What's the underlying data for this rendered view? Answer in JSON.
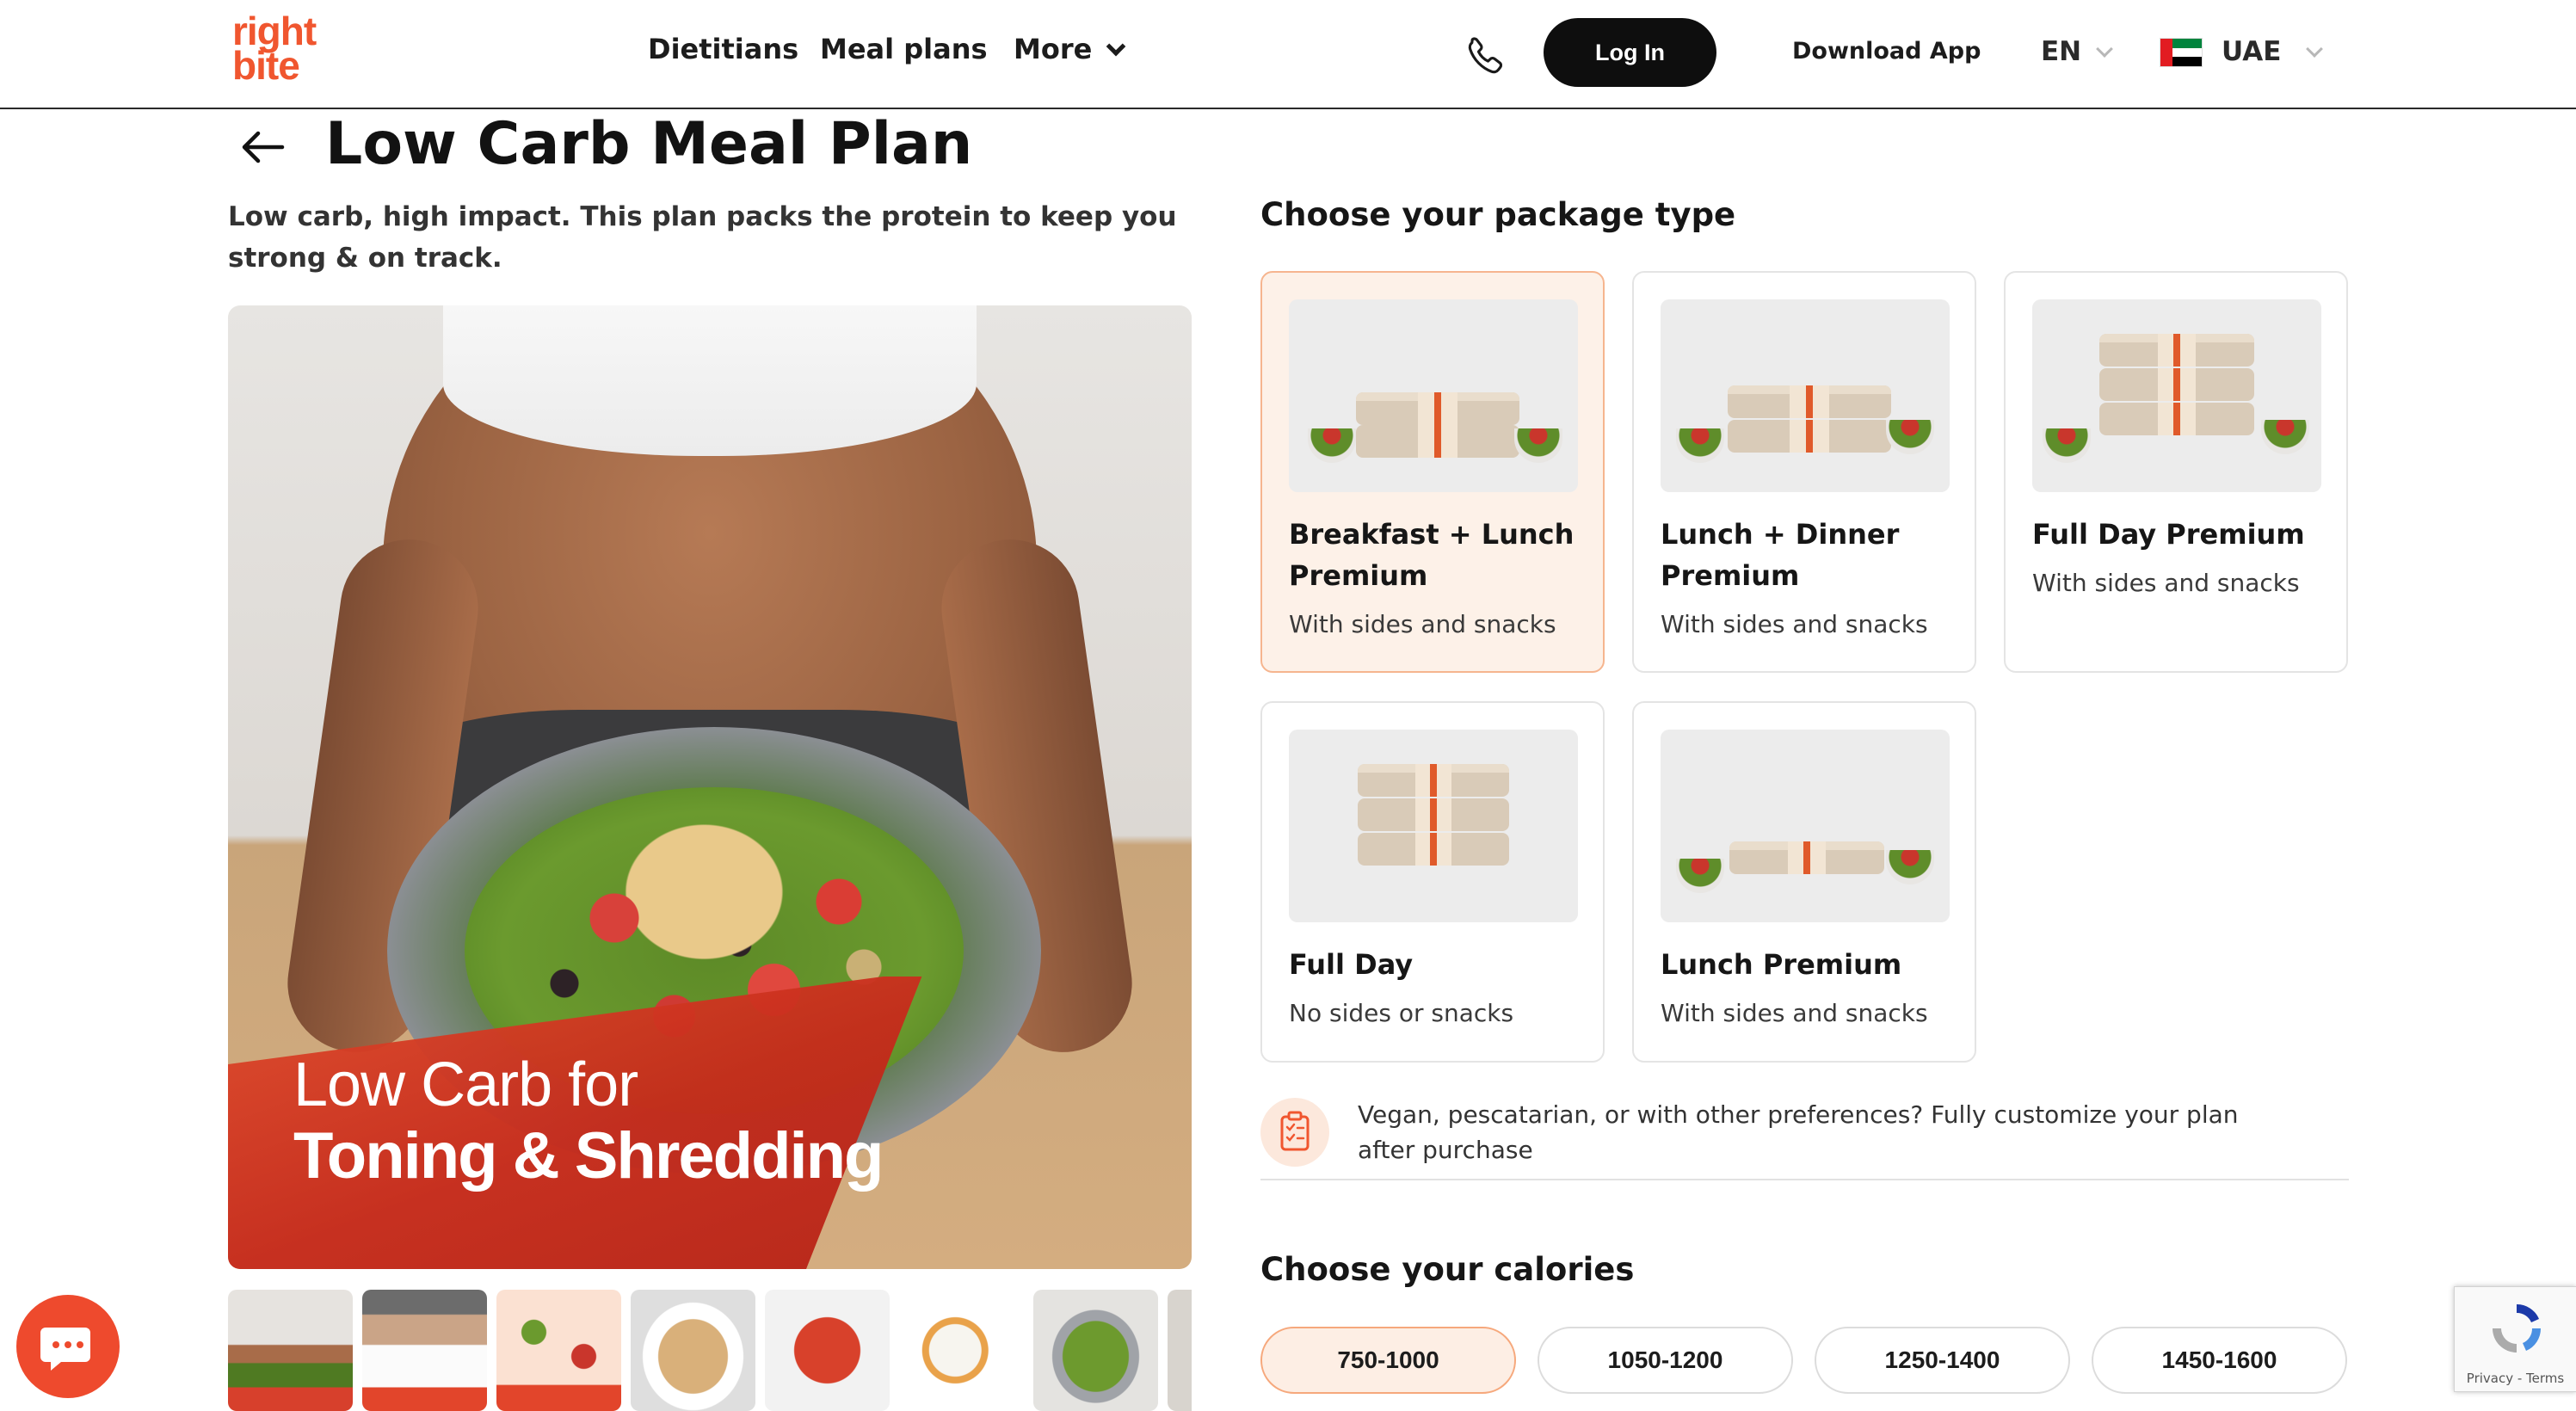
{
  "header": {
    "logo_line1": "right",
    "logo_line2": "bite",
    "nav": [
      "Dietitians",
      "Meal plans",
      "More"
    ],
    "login_label": "Log In",
    "download_label": "Download App",
    "language": "EN",
    "country": "UAE"
  },
  "plan": {
    "title": "Low Carb Meal Plan",
    "subtitle": "Low carb, high impact. This plan packs the protein to keep you strong & on track.",
    "banner_line1": "Low Carb for",
    "banner_line2": "Toning & Shredding"
  },
  "packages": {
    "heading": "Choose your package type",
    "items": [
      {
        "name": "Breakfast + Lunch Premium",
        "desc": "With sides and snacks",
        "selected": true
      },
      {
        "name": "Lunch + Dinner Premium",
        "desc": "With sides and snacks",
        "selected": false
      },
      {
        "name": "Full Day Premium",
        "desc": "With sides and snacks",
        "selected": false
      },
      {
        "name": "Full Day",
        "desc": "No sides or snacks",
        "selected": false
      },
      {
        "name": "Lunch Premium",
        "desc": "With sides and snacks",
        "selected": false
      }
    ],
    "note": "Vegan, pescatarian, or with other preferences? Fully customize your plan after purchase"
  },
  "calories": {
    "heading": "Choose your calories",
    "options": [
      "750-1000",
      "1050-1200",
      "1250-1400",
      "1450-1600"
    ],
    "selected_index": 0
  },
  "recaptcha": {
    "label": "Privacy - Terms"
  },
  "colors": {
    "brand": "#f0562f",
    "selected_bg": "#fdf1e8",
    "selected_border": "#f6b58f"
  },
  "icons": [
    "phone-icon",
    "chevron-down-icon",
    "back-arrow-icon",
    "clipboard-list-icon",
    "chat-icon",
    "recaptcha-icon"
  ]
}
